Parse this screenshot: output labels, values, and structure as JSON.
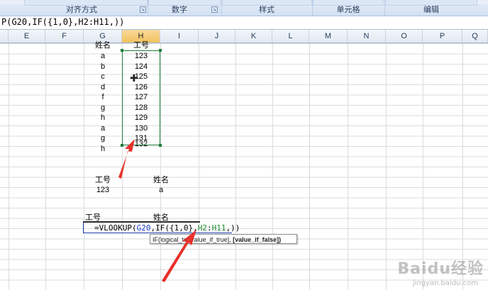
{
  "ribbon": {
    "groups": [
      "对齐方式",
      "数字",
      "样式",
      "单元格",
      "编辑"
    ]
  },
  "formula_bar": {
    "text": "P(G20,IF({1,0},H2:H11,))"
  },
  "columns": [
    "E",
    "F",
    "G",
    "H",
    "I",
    "J",
    "K",
    "L",
    "M",
    "N",
    "O",
    "P",
    "Q"
  ],
  "selected_column": "H",
  "table1": {
    "header_name": "姓名",
    "header_id": "工号",
    "names": [
      "a",
      "b",
      "c",
      "d",
      "f",
      "g",
      "h",
      "a",
      "g",
      "h"
    ],
    "ids": [
      "123",
      "124",
      "125",
      "126",
      "127",
      "128",
      "129",
      "130",
      "131",
      "132"
    ]
  },
  "lookup1": {
    "label_id": "工号",
    "label_name": "姓名",
    "value_id": "123",
    "value_name": "a"
  },
  "lookup2": {
    "label_id": "工号",
    "label_name": "姓名",
    "formula_parts": {
      "prefix": "=VLOOKUP(",
      "ref1": "G20",
      "mid": ",IF({1,0},",
      "ref2": "H2",
      "colon": ":",
      "ref3": "H11",
      "suffix": ",))"
    }
  },
  "tooltip": {
    "text": "IF(logical_te",
    "middle": "[value_if_true],",
    "bold": "[value_if_false])"
  },
  "colors": {
    "ref_blue": "#1f3fd1",
    "ref_green": "#1f8a2e",
    "arrow_red": "#e8312a",
    "selection_green": "#1e7b3c"
  },
  "watermark": {
    "brand": "Baidu经验",
    "sub": "jingyan.baidu.com"
  }
}
